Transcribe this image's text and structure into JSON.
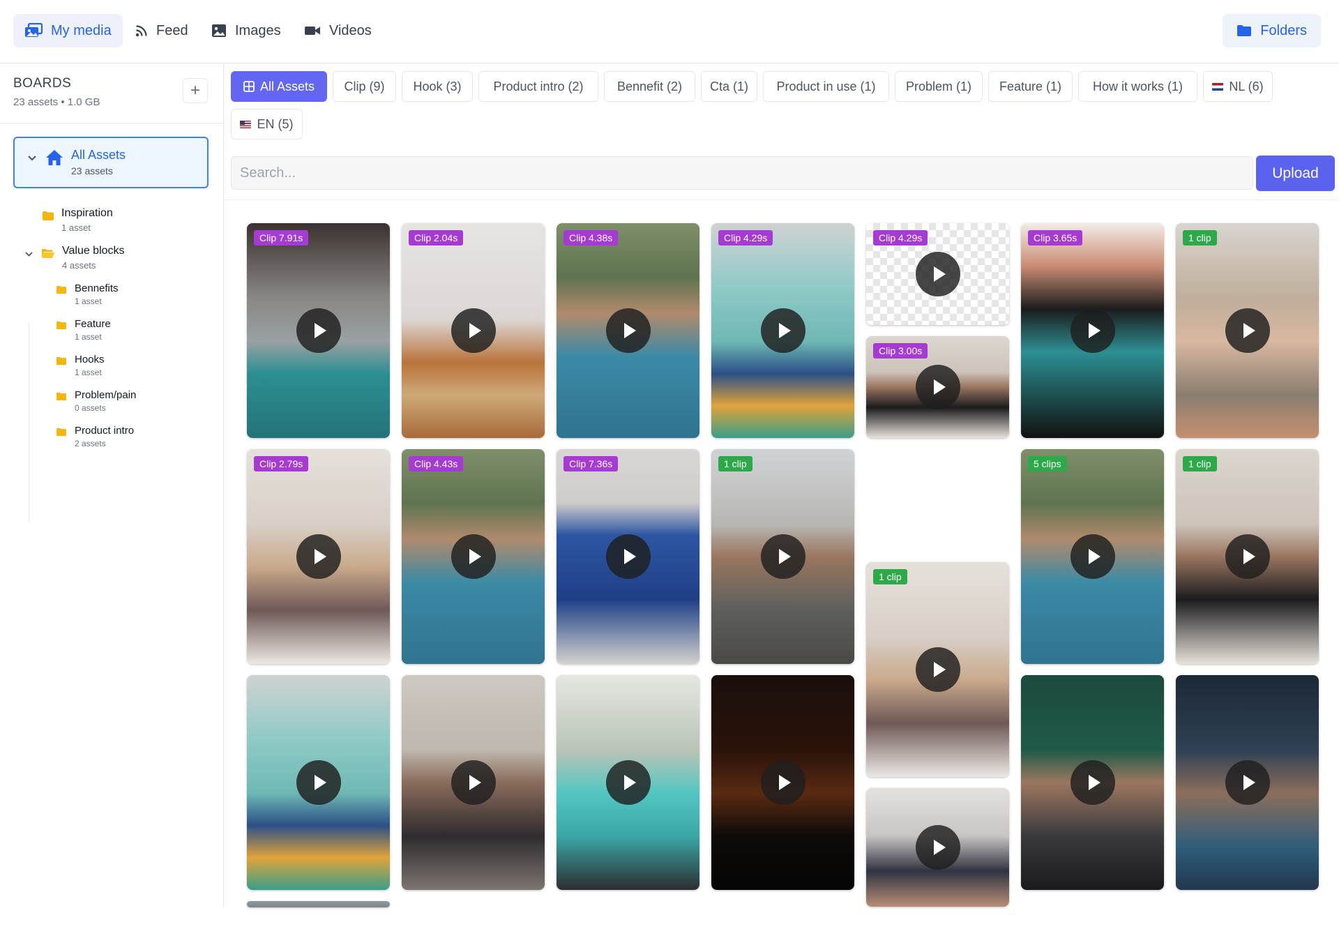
{
  "nav": {
    "tabs": [
      {
        "label": "My media",
        "icon": "media-library-icon",
        "active": true
      },
      {
        "label": "Feed",
        "icon": "rss-feed-icon",
        "active": false
      },
      {
        "label": "Images",
        "icon": "image-icon",
        "active": false
      },
      {
        "label": "Videos",
        "icon": "video-camera-icon",
        "active": false
      }
    ],
    "folders_label": "Folders",
    "accent_color": "#2563eb"
  },
  "sidebar": {
    "title": "BOARDS",
    "subtitle": "23 assets • 1.0 GB",
    "add_symbol": "+",
    "root": {
      "name": "All Assets",
      "count": "23 assets"
    },
    "folders": [
      {
        "name": "Inspiration",
        "count": "1 asset",
        "level": 1
      },
      {
        "name": "Value blocks",
        "count": "4 assets",
        "level": 1,
        "expanded": true
      },
      {
        "name": "Bennefits",
        "count": "1 asset",
        "level": 2
      },
      {
        "name": "Feature",
        "count": "1 asset",
        "level": 2
      },
      {
        "name": "Hooks",
        "count": "1 asset",
        "level": 2
      },
      {
        "name": "Problem/pain",
        "count": "0 assets",
        "level": 2
      },
      {
        "name": "Product intro",
        "count": "2 assets",
        "level": 2
      }
    ]
  },
  "filters": {
    "chips": [
      {
        "label": "All Assets",
        "active": true,
        "icon": "grid-icon"
      },
      {
        "label": "Clip (9)"
      },
      {
        "label": "Hook (3)"
      },
      {
        "label": "Product intro (2)"
      },
      {
        "label": "Bennefit (2)"
      },
      {
        "label": "Cta (1)"
      },
      {
        "label": "Product in use (1)"
      },
      {
        "label": "Problem (1)"
      },
      {
        "label": "Feature (1)"
      },
      {
        "label": "How it works (1)"
      },
      {
        "label": "NL (6)",
        "flag": "nl"
      },
      {
        "label": "EN (5)",
        "flag": "en"
      }
    ]
  },
  "search": {
    "placeholder": "Search...",
    "value": ""
  },
  "upload_label": "Upload",
  "colors": {
    "clip_badge": "#a63bd4",
    "count_badge": "#2ea94a",
    "primary": "#5b63ee"
  },
  "tiles": [
    {
      "badge": "Clip 7.91s",
      "badge_type": "clip",
      "desc": "shaker pour",
      "bg": "shaker"
    },
    {
      "badge": "Clip 2.04s",
      "badge_type": "clip",
      "desc": "oats closeup",
      "bg": "oats"
    },
    {
      "badge": "Clip 4.38s",
      "badge_type": "clip",
      "desc": "man outdoors",
      "bg": "man-blue"
    },
    {
      "badge": "Clip 4.29s",
      "badge_type": "clip",
      "desc": "product boxes",
      "bg": "boxes"
    },
    {
      "badge": "Clip 4.29s",
      "badge_type": "clip",
      "desc": "transparent",
      "bg": "checker"
    },
    {
      "badge": "Clip 3.65s",
      "badge_type": "clip",
      "desc": "shaker dark",
      "bg": "shaker-dark"
    },
    {
      "badge": "1 clip",
      "badge_type": "count",
      "desc": "woman kitchen",
      "bg": "woman-kitchen"
    },
    {
      "badge": "Clip 3.00s",
      "badge_type": "clip",
      "desc": "man black tee",
      "bg": "man-black"
    },
    {
      "badge": "Clip 2.79s",
      "badge_type": "clip",
      "desc": "woman table",
      "bg": "woman-table"
    },
    {
      "badge": "Clip 4.43s",
      "badge_type": "clip",
      "desc": "man pointing",
      "bg": "man-blue"
    },
    {
      "badge": "Clip 7.36s",
      "badge_type": "clip",
      "desc": "blue bag",
      "bg": "bag"
    },
    {
      "badge": "1 clip",
      "badge_type": "count",
      "desc": "man kitchen",
      "bg": "man-kitchen"
    },
    {
      "badge": "1 clip",
      "badge_type": "count",
      "desc": "woman table",
      "bg": "woman-table"
    },
    {
      "badge": "5 clips",
      "badge_type": "count",
      "desc": "man outdoors",
      "bg": "man-blue"
    },
    {
      "badge": "1 clip",
      "badge_type": "count",
      "desc": "man black tee",
      "bg": "man-black"
    },
    {
      "badge": "",
      "badge_type": "none",
      "desc": "product boxes",
      "bg": "boxes"
    },
    {
      "badge": "",
      "badge_type": "none",
      "desc": "woman phone",
      "bg": "woman-phone"
    },
    {
      "badge": "",
      "badge_type": "none",
      "desc": "teal cups",
      "bg": "cups"
    },
    {
      "badge": "",
      "badge_type": "none",
      "desc": "alarm clock",
      "bg": "clock"
    },
    {
      "badge": "",
      "badge_type": "none",
      "desc": "woman bag",
      "bg": "woman-bag"
    },
    {
      "badge": "",
      "badge_type": "none",
      "desc": "woman green wall",
      "bg": "woman-green"
    },
    {
      "badge": "",
      "badge_type": "none",
      "desc": "man car",
      "bg": "man-car"
    },
    {
      "badge": "",
      "badge_type": "none",
      "desc": "partial tile",
      "bg": "partial"
    }
  ]
}
